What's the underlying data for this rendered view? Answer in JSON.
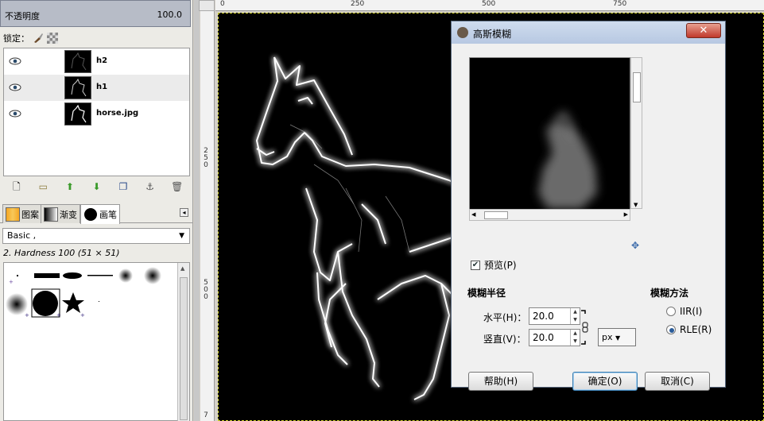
{
  "layers_panel": {
    "opacity_label": "不透明度",
    "opacity_value": "100.0",
    "lock_label": "锁定：",
    "layers": [
      {
        "name": "h2",
        "visible": true,
        "selected": false
      },
      {
        "name": "h1",
        "visible": true,
        "selected": true
      },
      {
        "name": "horse.jpg",
        "visible": true,
        "selected": false
      }
    ],
    "buttons": [
      "new-layer-icon",
      "folder-icon",
      "raise-layer-icon",
      "lower-layer-icon",
      "duplicate-layer-icon",
      "anchor-icon",
      "delete-icon"
    ]
  },
  "brush_panel": {
    "tabs": [
      {
        "label": "图案",
        "active": false
      },
      {
        "label": "渐变",
        "active": false
      },
      {
        "label": "画笔",
        "active": true
      }
    ],
    "preset_select": "Basic ,",
    "current_brush": "2. Hardness 100 (51 × 51)"
  },
  "rulers": {
    "top_labels": [
      "0",
      "250",
      "500",
      "750"
    ],
    "left_labels": [
      "2 5 0",
      "5 0 0",
      "7"
    ]
  },
  "dialog": {
    "title": "高斯模糊",
    "close_label": "✕",
    "preview_label": "预览(P)",
    "preview_checked": true,
    "radius_header": "模糊半径",
    "horizontal_label": "水平(H)：",
    "horizontal_value": "20.0",
    "vertical_label": "竖直(V)：",
    "vertical_value": "20.0",
    "unit": "px",
    "method_header": "模糊方法",
    "methods": [
      {
        "label": "IIR(I)",
        "selected": false
      },
      {
        "label": "RLE(R)",
        "selected": true
      }
    ],
    "help_button": "帮助(H)",
    "ok_button": "确定(O)",
    "cancel_button": "取消(C)"
  },
  "colors": {
    "accent": "#2a5c9a",
    "canvas_bg": "#000000",
    "glow": "#ffffff"
  }
}
